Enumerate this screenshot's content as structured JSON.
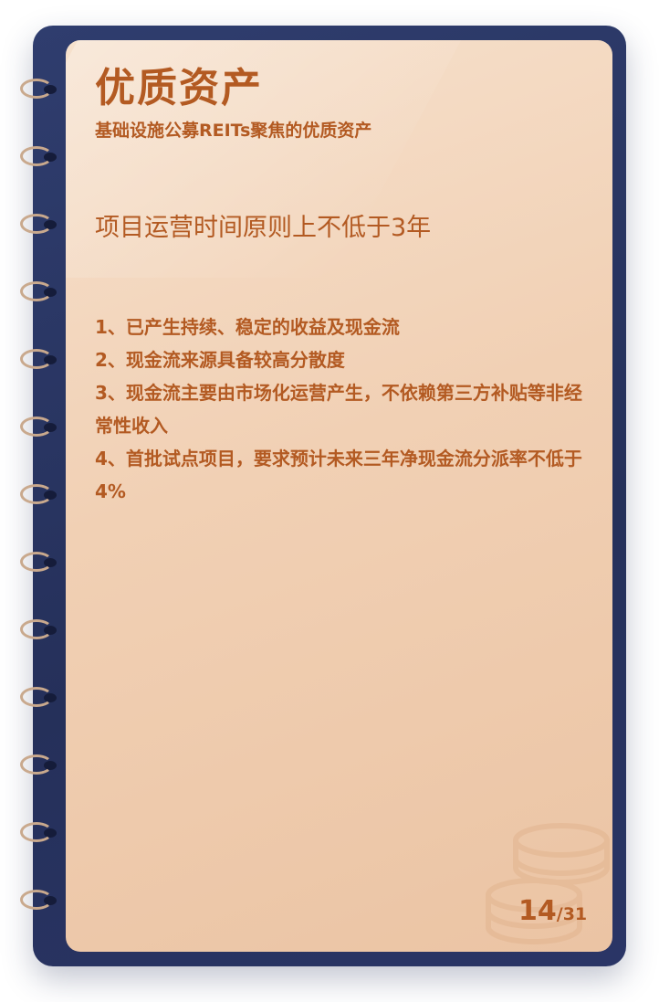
{
  "header": {
    "title": "优质资产",
    "subtitle": "基础设施公募REITs聚焦的优质资产"
  },
  "main": {
    "headline": "项目运营时间原则上不低于3年",
    "items": [
      "1、已产生持续、稳定的收益及现金流",
      "2、现金流来源具备较高分散度",
      "3、现金流主要由市场化运营产生，不依赖第三方补贴等非经常性收入",
      "4、首批试点项目，要求预计未来三年净现金流分派率不低于4%"
    ]
  },
  "pagination": {
    "current": "14",
    "total": "/31"
  },
  "colors": {
    "cover": "#2b3766",
    "paper": "#f1d0b4",
    "accent": "#b35a22",
    "ring": "#c9a98d"
  },
  "icons": {
    "binder_ring": "binder-ring-icon",
    "coins": "coin-stack-icon"
  }
}
